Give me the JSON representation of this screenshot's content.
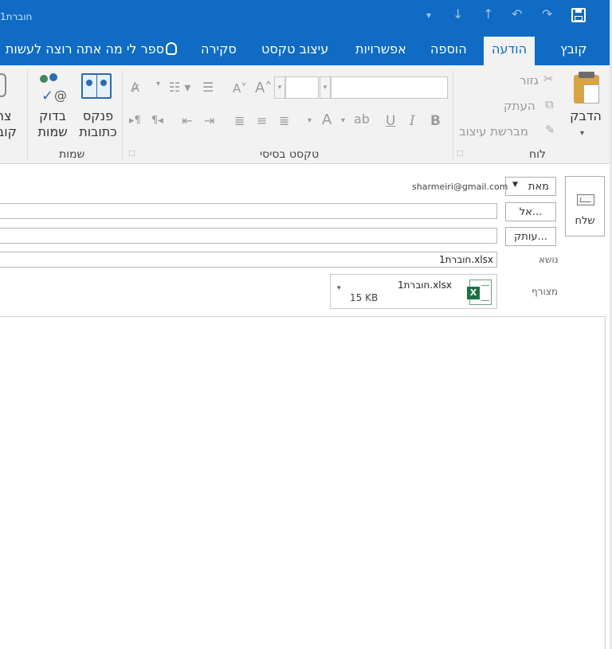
{
  "window": {
    "title": "חוברת1"
  },
  "tabs": [
    "קובץ",
    "הודעה",
    "הוספה",
    "אפשרויות",
    "עיצוב טקסט",
    "סקירה"
  ],
  "active_tab": "הודעה",
  "tell_me": "ספר לי מה אתה רוצה לעשות",
  "ribbon": {
    "clipboard": {
      "label": "לוח",
      "paste": "הדבק",
      "cut": "גזור",
      "copy": "העתק",
      "format_painter": "מברשת עיצוב"
    },
    "basic_text": {
      "label": "טקסט בסיסי",
      "bold": "B",
      "italic": "I",
      "underline": "U"
    },
    "names": {
      "label": "שמות",
      "address_book_l1": "פנקס",
      "address_book_l2": "כתובות",
      "check_names_l1": "בדוק",
      "check_names_l2": "שמות"
    },
    "include": {
      "attach_l1": "צר",
      "attach_l2": "קוב"
    }
  },
  "compose": {
    "send": "שלח",
    "from_button": "מאת",
    "from_email": "sharmeiri@gmail.com",
    "to_button": "אל...",
    "cc_button": "עותק...",
    "subject_label": "נושא",
    "subject_value": "חוברת1.xlsx",
    "attached_label": "מצורף",
    "attachment": {
      "name": "חוברת1.xlsx",
      "size": "15 KB"
    }
  },
  "colors": {
    "brand": "#0f6bc4",
    "ribbon_bg": "#f2f2f2",
    "excel_green": "#1e7145"
  }
}
